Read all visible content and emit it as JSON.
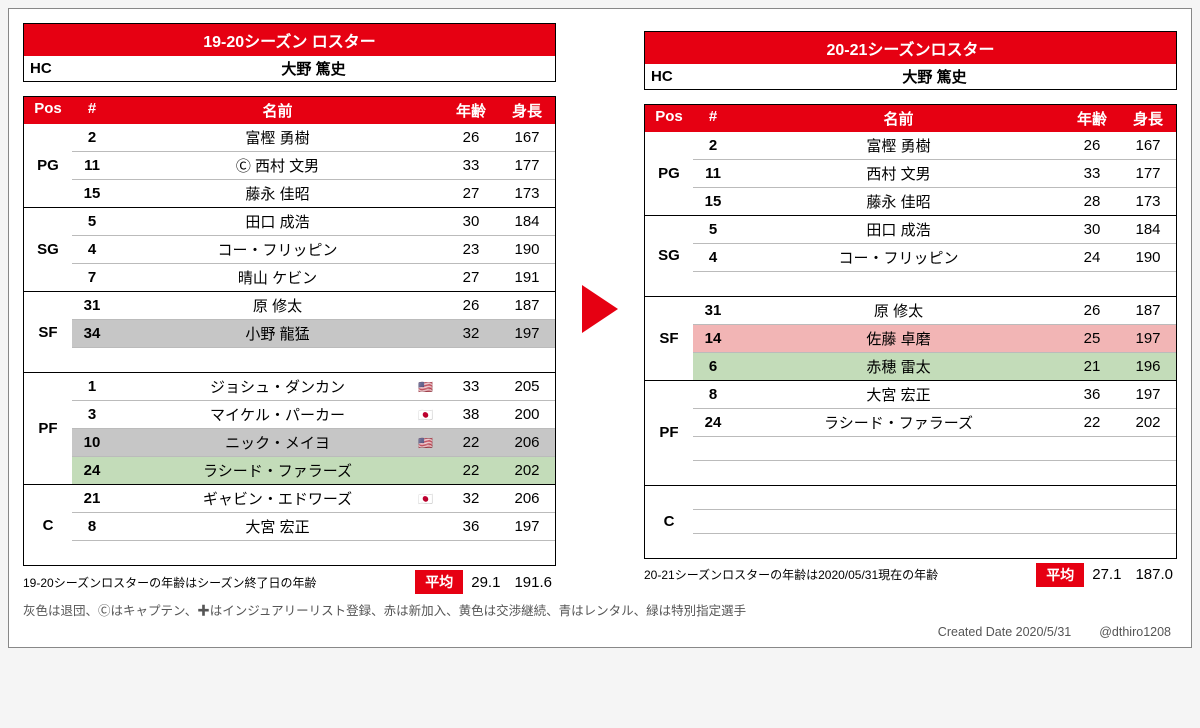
{
  "left": {
    "title": "19-20シーズン ロスター",
    "hc_label": "HC",
    "hc_name": "大野 篤史",
    "columns": {
      "pos": "Pos",
      "num": "#",
      "name": "名前",
      "age": "年齢",
      "height": "身長"
    },
    "groups": [
      {
        "pos": "PG",
        "slots": 3,
        "rows": [
          {
            "num": "2",
            "name": "富樫 勇樹",
            "age": "26",
            "height": "167"
          },
          {
            "num": "11",
            "name": "Ⓒ 西村 文男",
            "age": "33",
            "height": "177"
          },
          {
            "num": "15",
            "name": "藤永 佳昭",
            "age": "27",
            "height": "173"
          }
        ]
      },
      {
        "pos": "SG",
        "slots": 3,
        "rows": [
          {
            "num": "5",
            "name": "田口 成浩",
            "age": "30",
            "height": "184"
          },
          {
            "num": "4",
            "name": "コー・フリッピン",
            "age": "23",
            "height": "190"
          },
          {
            "num": "7",
            "name": "晴山 ケビン",
            "age": "27",
            "height": "191"
          }
        ]
      },
      {
        "pos": "SF",
        "slots": 3,
        "rows": [
          {
            "num": "31",
            "name": "原 修太",
            "age": "26",
            "height": "187"
          },
          {
            "num": "34",
            "name": "小野 龍猛",
            "age": "32",
            "height": "197",
            "hl": "gray"
          }
        ]
      },
      {
        "pos": "PF",
        "slots": 4,
        "rows": [
          {
            "num": "1",
            "name": "ジョシュ・ダンカン",
            "age": "33",
            "height": "205",
            "flag": "🇺🇸"
          },
          {
            "num": "3",
            "name": "マイケル・パーカー",
            "age": "38",
            "height": "200",
            "flag": "🇯🇵"
          },
          {
            "num": "10",
            "name": "ニック・メイヨ",
            "age": "22",
            "height": "206",
            "flag": "🇺🇸",
            "hl": "gray"
          },
          {
            "num": "24",
            "name": "ラシード・ファラーズ",
            "age": "22",
            "height": "202",
            "hl": "green"
          }
        ]
      },
      {
        "pos": "C",
        "slots": 3,
        "rows": [
          {
            "num": "21",
            "name": "ギャビン・エドワーズ",
            "age": "32",
            "height": "206",
            "flag": "🇯🇵"
          },
          {
            "num": "8",
            "name": "大宮 宏正",
            "age": "36",
            "height": "197"
          }
        ]
      }
    ],
    "footnote": "19-20シーズンロスターの年齢はシーズン終了日の年齢",
    "avg_label": "平均",
    "avg_age": "29.1",
    "avg_height": "191.6"
  },
  "right": {
    "title": "20-21シーズンロスター",
    "hc_label": "HC",
    "hc_name": "大野 篤史",
    "columns": {
      "pos": "Pos",
      "num": "#",
      "name": "名前",
      "age": "年齢",
      "height": "身長"
    },
    "groups": [
      {
        "pos": "PG",
        "slots": 3,
        "rows": [
          {
            "num": "2",
            "name": "富樫 勇樹",
            "age": "26",
            "height": "167"
          },
          {
            "num": "11",
            "name": "西村 文男",
            "age": "33",
            "height": "177"
          },
          {
            "num": "15",
            "name": "藤永 佳昭",
            "age": "28",
            "height": "173"
          }
        ]
      },
      {
        "pos": "SG",
        "slots": 3,
        "rows": [
          {
            "num": "5",
            "name": "田口 成浩",
            "age": "30",
            "height": "184"
          },
          {
            "num": "4",
            "name": "コー・フリッピン",
            "age": "24",
            "height": "190"
          }
        ]
      },
      {
        "pos": "SF",
        "slots": 3,
        "rows": [
          {
            "num": "31",
            "name": "原 修太",
            "age": "26",
            "height": "187"
          },
          {
            "num": "14",
            "name": "佐藤 卓磨",
            "age": "25",
            "height": "197",
            "hl": "pink"
          },
          {
            "num": "6",
            "name": "赤穂 雷太",
            "age": "21",
            "height": "196",
            "hl": "green"
          }
        ]
      },
      {
        "pos": "PF",
        "slots": 4,
        "rows": [
          {
            "num": "8",
            "name": "大宮 宏正",
            "age": "36",
            "height": "197"
          },
          {
            "num": "24",
            "name": "ラシード・ファラーズ",
            "age": "22",
            "height": "202"
          }
        ]
      },
      {
        "pos": "C",
        "slots": 3,
        "rows": []
      }
    ],
    "footnote": "20-21シーズンロスターの年齢は2020/05/31現在の年齢",
    "avg_label": "平均",
    "avg_age": "27.1",
    "avg_height": "187.0"
  },
  "legend": "灰色は退団、Ⓒはキャプテン、✚はインジュアリーリスト登録、赤は新加入、黄色は交渉継続、青はレンタル、緑は特別指定選手",
  "credits": {
    "date": "Created Date 2020/5/31",
    "handle": "@dthiro1208"
  }
}
